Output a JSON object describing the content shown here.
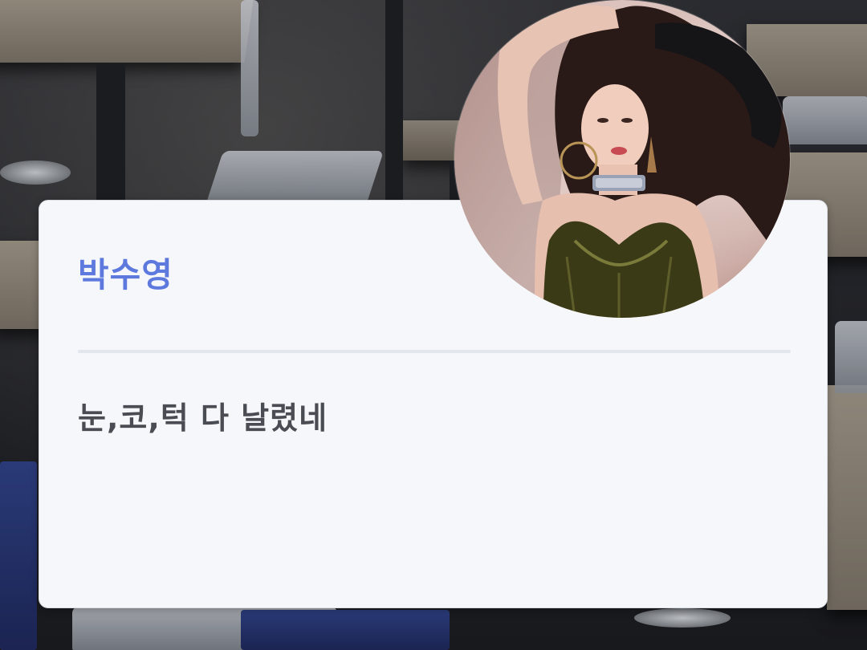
{
  "post": {
    "author_name": "박수영",
    "message": "눈,코,턱 다 날렸네"
  },
  "avatar": {
    "description_icon": "profile-photo"
  },
  "colors": {
    "author_name": "#5e79de",
    "message_text": "#4a4c53",
    "card_background": "#f6f7fa",
    "divider": "#e3e6ec"
  }
}
